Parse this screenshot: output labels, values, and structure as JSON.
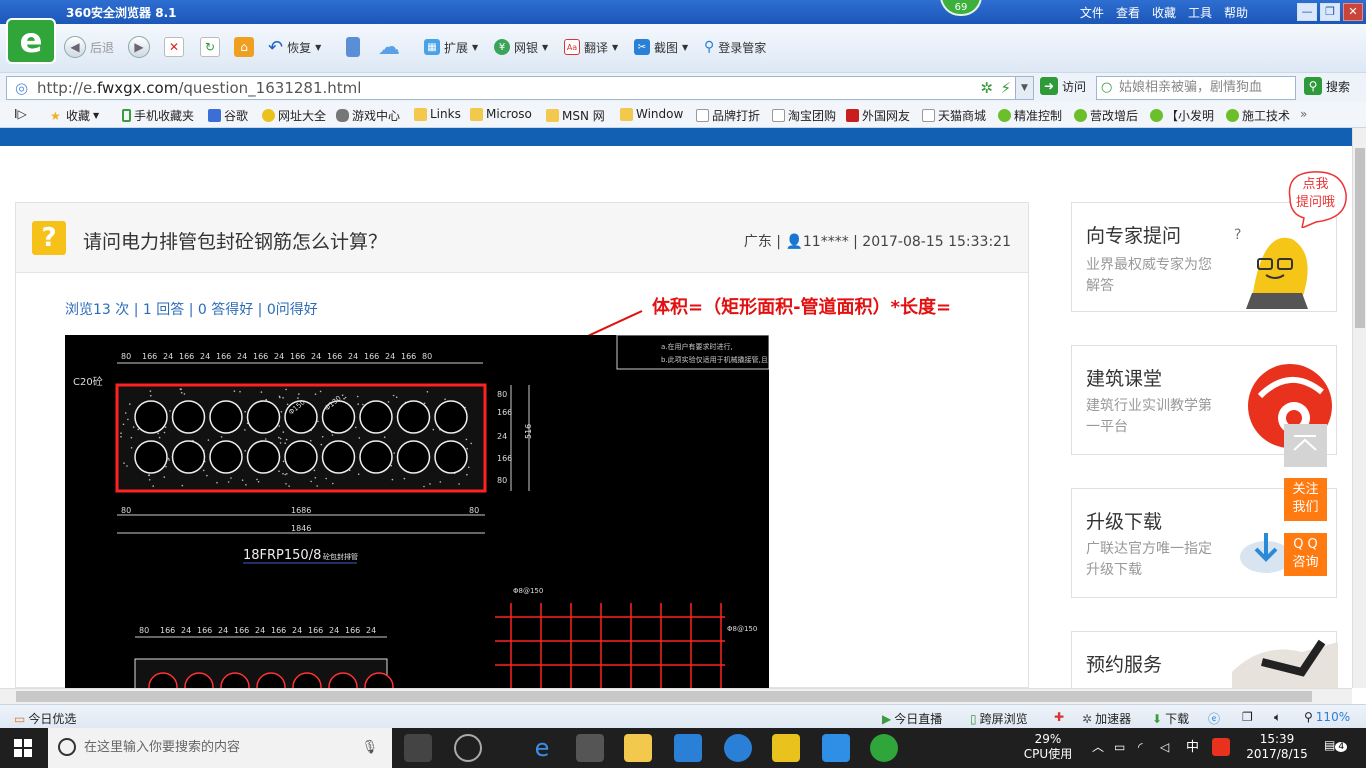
{
  "browser": {
    "title": "360安全浏览器 8.1",
    "menus": [
      "文件",
      "查看",
      "收藏",
      "工具",
      "帮助"
    ],
    "badge": "69",
    "toolbar": {
      "back": "后退",
      "restore": "恢复",
      "extend": "扩展",
      "bank": "网银",
      "translate": "翻译",
      "screenshot": "截图",
      "login": "登录管家"
    },
    "address": {
      "prefix": "http://e.",
      "domain": "fwxgx.com",
      "path": "/question_1631281.html",
      "visit": "访问",
      "search_placeholder": "姑娘相亲被骗，剧情狗血",
      "search_button": "搜索"
    },
    "favorites": [
      "收藏",
      "手机收藏夹",
      "谷歌",
      "网址大全",
      "游戏中心",
      "Links",
      "Microso",
      "MSN 网",
      "Window",
      "品牌打折",
      "淘宝团购",
      "外国网友",
      "天猫商城",
      "精准控制",
      "营改增后",
      "【小发明",
      "施工技术"
    ]
  },
  "question": {
    "title": "请问电力排管包封砼钢筋怎么计算？",
    "meta": "广东 | 👤11**** | 2017-08-15 15:33:21",
    "stats": "浏览13 次 | 1 回答 | 0 答得好 | 0问得好",
    "annotation": "体积=（矩形面积-管道面积）*长度=",
    "drawing": {
      "top_dims": [
        "80",
        "166",
        "24",
        "166",
        "24",
        "166",
        "24",
        "166",
        "24",
        "166",
        "24",
        "166",
        "24",
        "166",
        "24",
        "166",
        "80"
      ],
      "concrete": "C20砼",
      "right_dims": [
        "80",
        "166",
        "24",
        "166",
        "80"
      ],
      "total_height": "516",
      "bottom_dims": [
        "80",
        "1686",
        "80"
      ],
      "total_width": "1846",
      "caption": "18FRP150/8",
      "caption_small": "砼包封排管",
      "notes": [
        "a.在用户有要求时进行,",
        "b.此项实验仅适用于机械撬接管,且"
      ],
      "pipe_labels": [
        "Φ150",
        "Φ130"
      ],
      "rebar_top": "Φ8@150",
      "rebar_right": "Φ8@150"
    }
  },
  "sidebar": {
    "bubble": [
      "点我",
      "提问哦"
    ],
    "cards": [
      {
        "title": "向专家提问",
        "sub": "业界最权威专家为您解答"
      },
      {
        "title": "建筑课堂",
        "sub": "建筑行业实训教学第一平台"
      },
      {
        "title": "升级下载",
        "sub": "广联达官方唯一指定升级下载"
      },
      {
        "title": "预约服务",
        "sub": ""
      }
    ],
    "follow": [
      "关注",
      "我们"
    ],
    "qq": [
      "Q Q",
      "咨询"
    ]
  },
  "statusbar": {
    "left": "今日优选",
    "live": "今日直播",
    "cross": "跨屏浏览",
    "accelerator": "加速器",
    "download": "下载",
    "zoom": "110%"
  },
  "taskbar": {
    "search_placeholder": "在这里输入你要搜索的内容",
    "cpu_percent": "29%",
    "cpu_label": "CPU使用",
    "ime": "中",
    "time": "15:39",
    "date": "2017/8/15",
    "notifications": "4"
  },
  "colors": {
    "accent_blue": "#1260b3",
    "annotation_red": "#e31010",
    "orange": "#ff7b12"
  }
}
